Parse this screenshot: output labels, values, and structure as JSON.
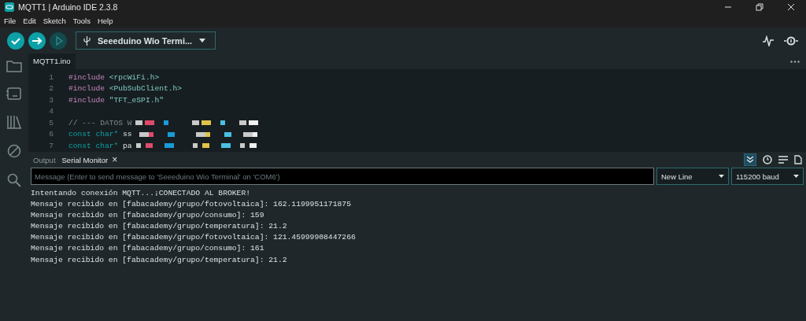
{
  "window": {
    "title": "MQTT1 | Arduino IDE 2.3.8"
  },
  "menu": [
    "File",
    "Edit",
    "Sketch",
    "Tools",
    "Help"
  ],
  "toolbar": {
    "buttons": [
      {
        "kind": "verify",
        "disabled": false
      },
      {
        "kind": "upload",
        "disabled": false
      },
      {
        "kind": "debug",
        "disabled": true
      }
    ],
    "board": "Seeeduino Wio Termi..."
  },
  "sidebar": [
    {
      "kind": "sketchbook"
    },
    {
      "kind": "boards"
    },
    {
      "kind": "library"
    },
    {
      "kind": "debug"
    },
    {
      "kind": "search"
    }
  ],
  "editor": {
    "tab": "MQTT1.ino",
    "lines": [
      {
        "number": "1",
        "tokens": [
          {
            "kind": "directive",
            "text": "#include"
          },
          {
            "kind": "string",
            "text": " <rpcWiFi.h>"
          }
        ]
      },
      {
        "number": "2",
        "tokens": [
          {
            "kind": "directive",
            "text": "#include"
          },
          {
            "kind": "string",
            "text": " <PubSubClient.h>"
          }
        ]
      },
      {
        "number": "3",
        "tokens": [
          {
            "kind": "directive",
            "text": "#include"
          },
          {
            "kind": "string",
            "text": " \"TFT_eSPI.h\""
          }
        ]
      },
      {
        "number": "4"
      },
      {
        "number": "5",
        "tokens": [
          {
            "kind": "comment",
            "text": "// --- DATOS W"
          }
        ],
        "redacted": true
      },
      {
        "number": "6",
        "tokens": [
          {
            "kind": "type",
            "text": "const char*"
          },
          {
            "kind": "plain",
            "text": " ss"
          }
        ],
        "redacted": true
      },
      {
        "number": "7",
        "tokens": [
          {
            "kind": "type",
            "text": "const char*"
          },
          {
            "kind": "plain",
            "text": " pa"
          }
        ],
        "redacted": true
      }
    ]
  },
  "serial_panel": {
    "tabs": [
      {
        "label": "Output",
        "selected": false
      },
      {
        "label": "Serial Monitor",
        "selected": true
      }
    ],
    "close": "×",
    "message": {
      "placeholder": "Message (Enter to send message to 'Seeeduino Wio Terminal' on 'COM6')"
    },
    "line_ending": "New Line",
    "baud": "115200 baud",
    "output": [
      "Intentando conexión MQTT...¡CONECTADO AL BROKER!",
      "Mensaje recibido en [fabacademy/grupo/fotovoltaica]: 162.1199951171875",
      "Mensaje recibido en [fabacademy/grupo/consumo]: 159",
      "Mensaje recibido en [fabacademy/grupo/temperatura]: 21.2",
      "Mensaje recibido en [fabacademy/grupo/fotovoltaica]: 121.45999908447266",
      "Mensaje recibido en [fabacademy/grupo/consumo]: 161",
      "Mensaje recibido en [fabacademy/grupo/temperatura]: 21.2"
    ]
  }
}
